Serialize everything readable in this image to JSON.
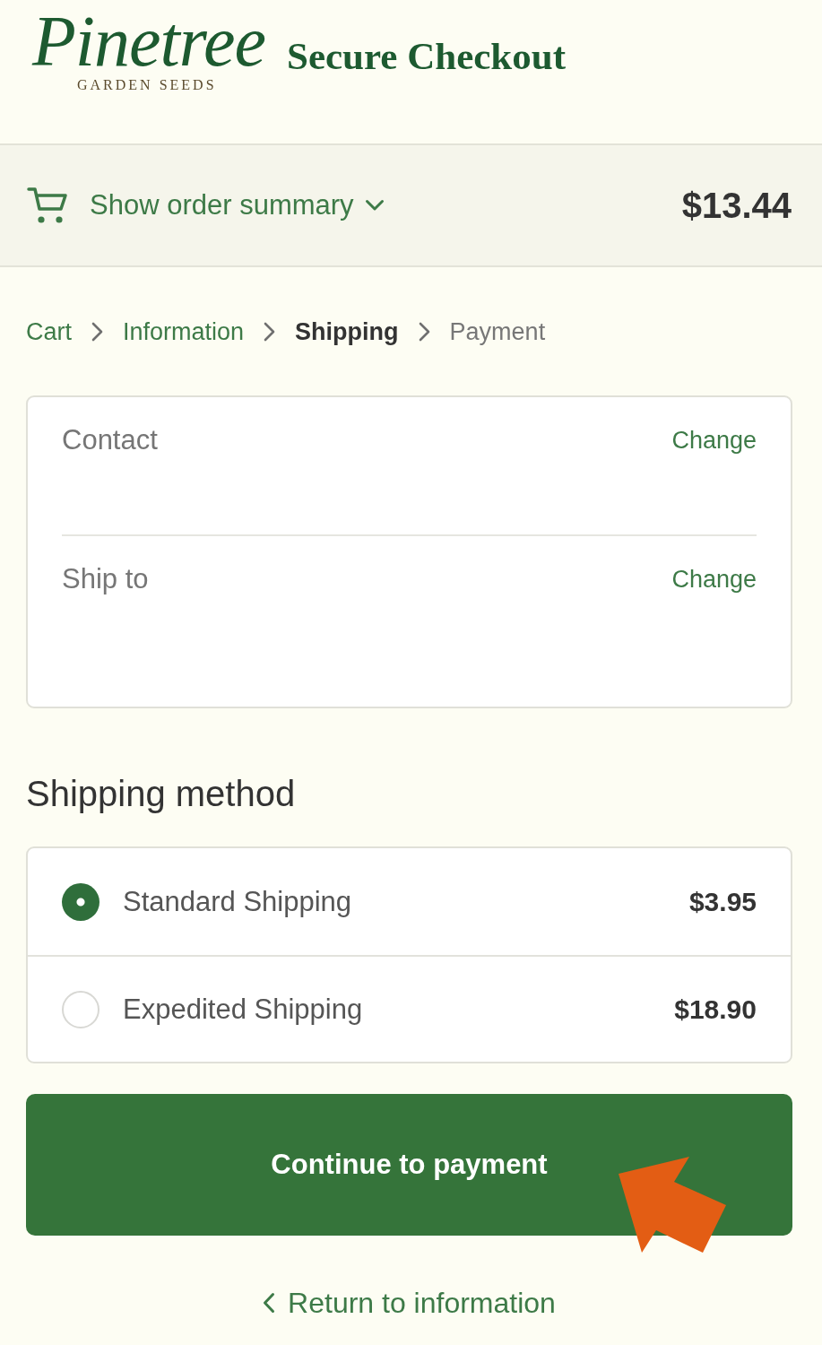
{
  "header": {
    "logo": {
      "wordmark": "Pinetree",
      "tagline": "GARDEN SEEDS"
    },
    "title": "Secure Checkout"
  },
  "order_summary": {
    "label": "Show order summary",
    "expanded": false,
    "total": "$13.44"
  },
  "breadcrumb": [
    {
      "label": "Cart",
      "completed": true,
      "selected": false
    },
    {
      "label": "Information",
      "completed": true,
      "selected": false
    },
    {
      "label": "Shipping",
      "completed": false,
      "selected": true
    },
    {
      "label": "Payment",
      "completed": false,
      "selected": false
    }
  ],
  "review": [
    {
      "label": "Contact",
      "action": "Change"
    },
    {
      "label": "Ship to",
      "action": "Change"
    }
  ],
  "shipping_method": {
    "heading": "Shipping method",
    "options": [
      {
        "label": "Standard Shipping",
        "price": "$3.95",
        "selected": true
      },
      {
        "label": "Expedited Shipping",
        "price": "$18.90",
        "selected": false
      }
    ]
  },
  "continue_button": "Continue to payment",
  "return_link": "Return to information"
}
